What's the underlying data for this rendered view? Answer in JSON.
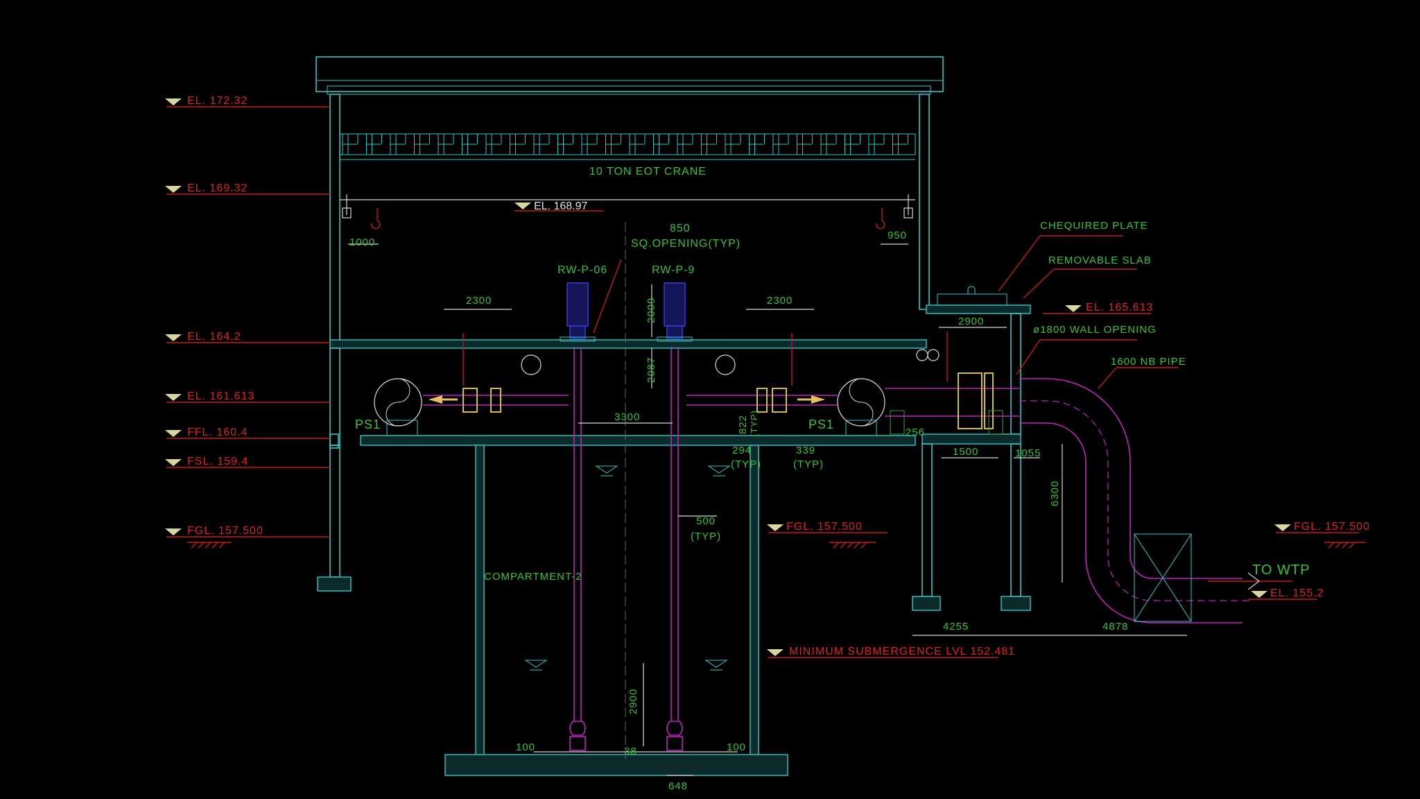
{
  "colors": {
    "background": "#000000",
    "structure": "#2ec7c7",
    "labels_green": "#36c436",
    "levels_red": "#e02020",
    "pipe_magenta": "#c020c0"
  },
  "crane": {
    "label": "10 TON EOT CRANE"
  },
  "levels_left": [
    {
      "label": "EL. 172.32"
    },
    {
      "label": "EL. 169.32"
    },
    {
      "label": "EL. 164.2"
    },
    {
      "label": "EL. 161.613"
    },
    {
      "label": "FFL. 160.4"
    },
    {
      "label": "FSL. 159.4"
    },
    {
      "label": "FGL. 157.500"
    }
  ],
  "level_crane_rail": "EL. 168.97",
  "level_fgl_mid": "FGL. 157.500",
  "level_fgl_right": "FGL. 157.500",
  "level_el_165": "EL. 165.613",
  "level_el_155": "EL. 155.2",
  "level_min_submergence": "MINIMUM SUBMERGENCE LVL 152.481",
  "opening": {
    "size": "850",
    "label": "SQ.OPENING(TYP)"
  },
  "pumps": {
    "left": "RW-P-06",
    "right": "RW-P-9"
  },
  "ps_left": "PS1",
  "ps_right": "PS1",
  "callouts": {
    "chequered_plate": "CHEQUIRED PLATE",
    "removable_slab": "REMOVABLE SLAB",
    "wall_opening": "ø1800 WALL OPENING",
    "pipe": "1600 NB PIPE",
    "compartment": "COMPARTMENT-2",
    "to_wtp": "TO WTP"
  },
  "dims": {
    "d1000": "1000",
    "d950": "950",
    "d2300_left": "2300",
    "d2300_right": "2300",
    "d2009": "2009",
    "d2087": "2087",
    "d3300": "3300",
    "d822": "822",
    "typ822": "(TYP)",
    "d294": "294",
    "typ294": "(TYP)",
    "d339": "339",
    "typ339": "(TYP)",
    "d2900_top": "2900",
    "d256": "256",
    "d1500": "1500",
    "d1055": "1055",
    "d6300": "6300",
    "d500": "500",
    "typ500": "(TYP)",
    "d4255": "4255",
    "d4878": "4878",
    "d2900_low": "2900",
    "d100_left": "100",
    "d100_right": "100",
    "d38": "38",
    "d648": "648"
  }
}
